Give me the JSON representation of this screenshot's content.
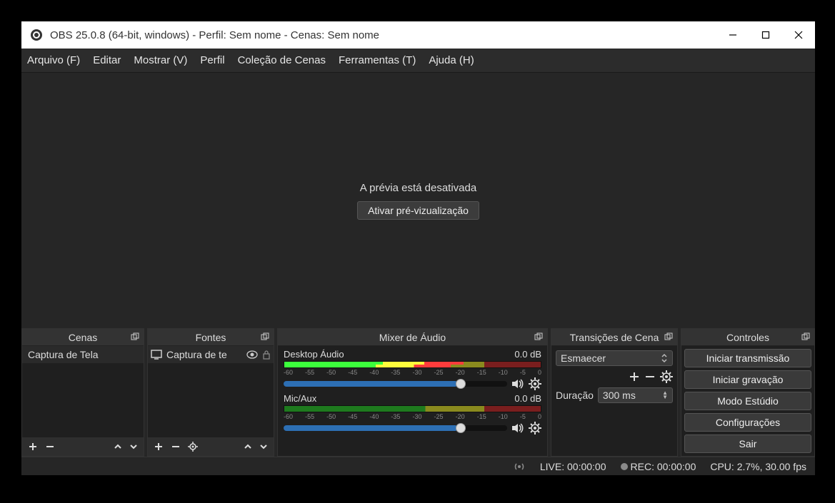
{
  "titlebar": {
    "title": "OBS 25.0.8 (64-bit, windows) - Perfil: Sem nome - Cenas: Sem nome"
  },
  "menu": {
    "file": "Arquivo (F)",
    "edit": "Editar",
    "view": "Mostrar (V)",
    "profile": "Perfil",
    "scene_col": "Coleção de Cenas",
    "tools": "Ferramentas (T)",
    "help": "Ajuda (H)"
  },
  "preview": {
    "disabled_msg": "A prévia está desativada",
    "enable_btn": "Ativar pré-vizualização"
  },
  "docks": {
    "scenes": {
      "title": "Cenas",
      "item0": "Captura de Tela"
    },
    "sources": {
      "title": "Fontes",
      "item0": "Captura de te"
    },
    "mixer": {
      "title": "Mixer de Áudio",
      "track0_name": "Desktop Áudio",
      "track0_db": "0.0 dB",
      "track1_name": "Mic/Aux",
      "track1_db": "0.0 dB",
      "ticks": {
        "t0": "-60",
        "t1": "-55",
        "t2": "-50",
        "t3": "-45",
        "t4": "-40",
        "t5": "-35",
        "t6": "-30",
        "t7": "-25",
        "t8": "-20",
        "t9": "-15",
        "t10": "-10",
        "t11": "-5",
        "t12": "0"
      }
    },
    "transitions": {
      "title": "Transições de Cena",
      "selected": "Esmaecer",
      "duration_label": "Duração",
      "duration_value": "300 ms"
    },
    "controls": {
      "title": "Controles",
      "start_stream": "Iniciar transmissão",
      "start_record": "Iniciar gravação",
      "studio_mode": "Modo Estúdio",
      "settings": "Configurações",
      "exit": "Sair"
    }
  },
  "status": {
    "live": "LIVE: 00:00:00",
    "rec": "REC: 00:00:00",
    "cpu": "CPU: 2.7%, 30.00 fps"
  }
}
